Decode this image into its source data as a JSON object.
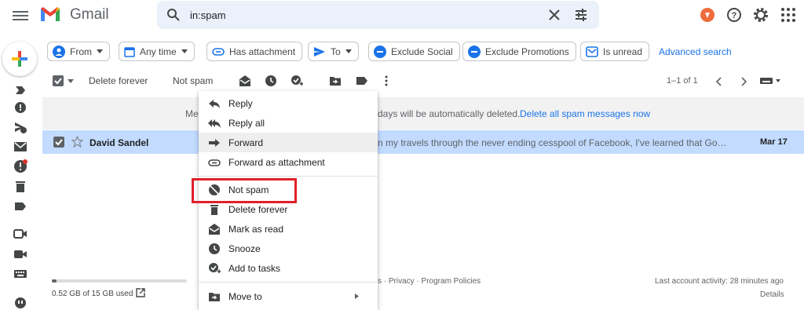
{
  "app": {
    "name": "Gmail"
  },
  "search": {
    "value": "in:spam"
  },
  "filters": [
    {
      "label": "From"
    },
    {
      "label": "Any time"
    },
    {
      "label": "Has attachment"
    },
    {
      "label": "To"
    },
    {
      "label": "Exclude Social"
    },
    {
      "label": "Exclude Promotions"
    },
    {
      "label": "Is unread"
    }
  ],
  "advanced_search": "Advanced search",
  "toolbar": {
    "delete_forever": "Delete forever",
    "not_spam": "Not spam",
    "pager": "1–1 of 1"
  },
  "banner": {
    "prefix": "Me",
    "text": "days will be automatically deleted.",
    "link": "Delete all spam messages now"
  },
  "email": {
    "sender": "David Sandel",
    "snippet": "n my travels through the never ending cesspool of Facebook, I've learned that Google A...",
    "date": "Mar 17"
  },
  "context_menu": {
    "items": [
      {
        "label": "Reply",
        "icon": "reply-icon"
      },
      {
        "label": "Reply all",
        "icon": "reply-all-icon"
      },
      {
        "label": "Forward",
        "icon": "forward-icon"
      },
      {
        "label": "Forward as attachment",
        "icon": "attachment-icon"
      },
      {
        "label": "Not spam",
        "icon": "not-spam-icon"
      },
      {
        "label": "Delete forever",
        "icon": "trash-icon"
      },
      {
        "label": "Mark as read",
        "icon": "mark-read-icon"
      },
      {
        "label": "Snooze",
        "icon": "clock-icon"
      },
      {
        "label": "Add to tasks",
        "icon": "add-task-icon"
      },
      {
        "label": "Move to",
        "icon": "move-to-icon"
      }
    ]
  },
  "footer": {
    "storage": "0.52 GB of 15 GB used",
    "storage_fraction": 0.035,
    "links": "s · Privacy · Program Policies",
    "activity": "Last account activity: 28 minutes ago",
    "details": "Details"
  },
  "colors": {
    "accent": "#1a73e8",
    "selected_row": "#c2dbff",
    "highlight": "#e0202b"
  }
}
